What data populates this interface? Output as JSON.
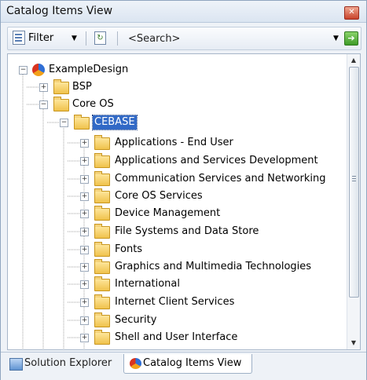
{
  "window": {
    "title": "Catalog Items View",
    "close_glyph": "✕"
  },
  "toolbar": {
    "filter_label": "Filter",
    "dropdown_glyph": "▼",
    "search": {
      "value": "<Search>",
      "placeholder": "<Search>"
    },
    "go_glyph": "➔"
  },
  "tree": {
    "root": "ExampleDesign",
    "bsp": "BSP",
    "core_os": "Core OS",
    "cebase": "CEBASE",
    "items": [
      "Applications - End User",
      "Applications and Services Development",
      "Communication Services and Networking",
      "Core OS Services",
      "Device Management",
      "File Systems and Data Store",
      "Fonts",
      "Graphics and Multimedia Technologies",
      "International",
      "Internet Client Services",
      "Security",
      "Shell and User Interface"
    ],
    "expand_glyph": "+",
    "collapse_glyph": "−"
  },
  "scrollbar": {
    "up_glyph": "▲",
    "down_glyph": "▼"
  },
  "tabs": {
    "solution_explorer": "Solution Explorer",
    "catalog_items_view": "Catalog Items View"
  },
  "icons": {
    "filter": "filter-icon",
    "refresh": "refresh-icon",
    "go": "go-arrow-icon",
    "folder": "folder-icon",
    "design": "design-globe-icon",
    "solution": "solution-explorer-icon"
  },
  "colors": {
    "selection": "#3169c6",
    "folder": "#f0c24c",
    "close": "#c8432b",
    "go": "#3e9b28"
  }
}
